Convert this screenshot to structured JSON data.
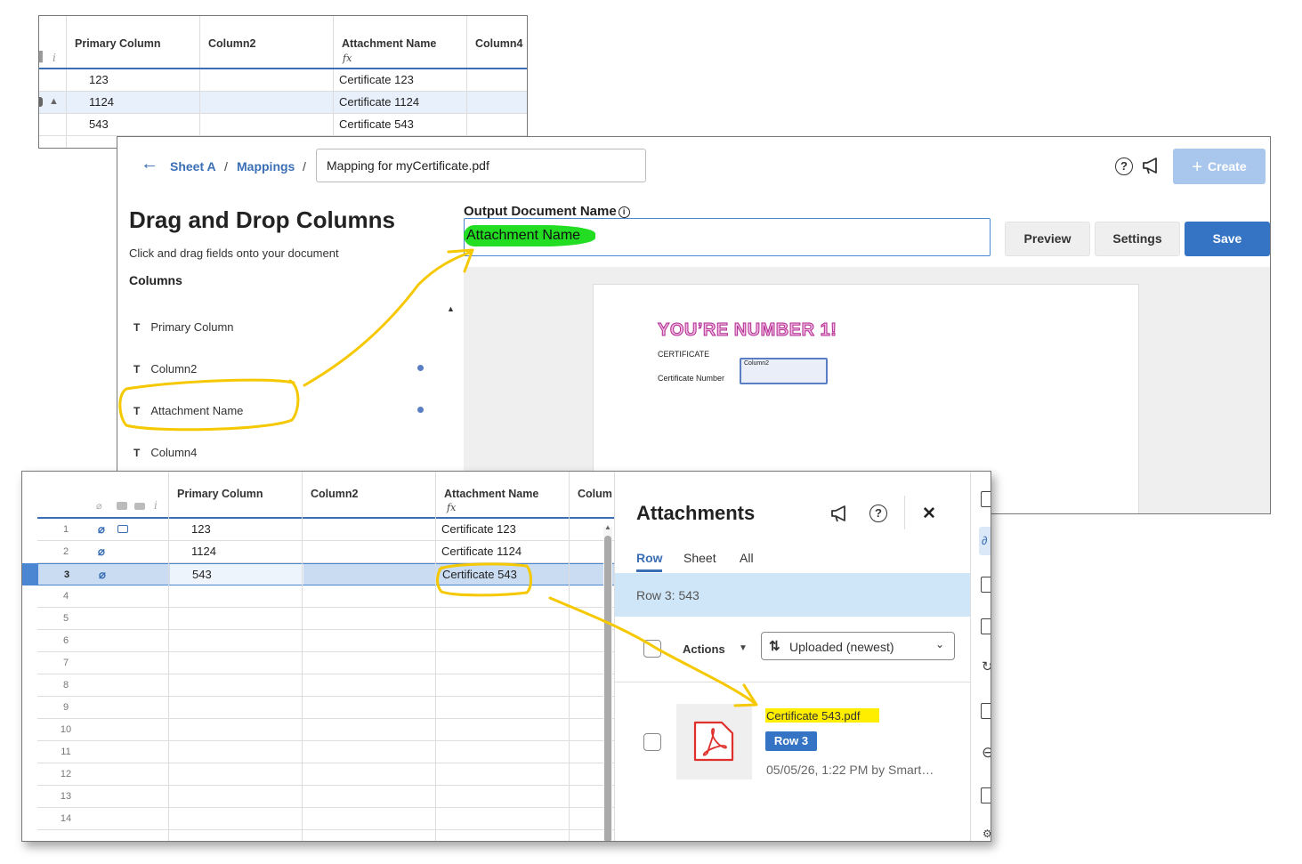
{
  "sheet_small": {
    "columns": [
      "Primary Column",
      "Column2",
      "Attachment Name",
      "Column4"
    ],
    "formula_icon": "fx",
    "info_icon": "i",
    "rows": [
      {
        "primary": "123",
        "column2": "",
        "attachment_name": "Certificate 123"
      },
      {
        "primary": "1124",
        "column2": "",
        "attachment_name": "Certificate 1124"
      },
      {
        "primary": "543",
        "column2": "",
        "attachment_name": "Certificate 543"
      }
    ]
  },
  "mapping": {
    "breadcrumb": {
      "back_icon": "←",
      "sheet": "Sheet A",
      "sep1": "/",
      "mappings": "Mappings",
      "sep2": "/"
    },
    "mapping_name": "Mapping for myCertificate.pdf",
    "help_icon": "?",
    "create_label": "Create",
    "create_icon": "+",
    "title": "Drag and Drop Columns",
    "subtitle": "Click and drag fields onto your document",
    "columns_heading": "Columns",
    "fields": [
      {
        "type": "T",
        "label": "Primary Column"
      },
      {
        "type": "T",
        "label": "Column2"
      },
      {
        "type": "T",
        "label": "Attachment Name"
      },
      {
        "type": "T",
        "label": "Column4"
      }
    ],
    "output_label": "Output Document Name",
    "output_info_icon": "i",
    "output_value": "Attachment Name",
    "preview_label": "Preview",
    "settings_label": "Settings",
    "save_label": "Save",
    "doc": {
      "headline": "YOU’RE NUMBER 1!",
      "certificate": "CERTIFICATE",
      "number_label": "Certificate Number",
      "field_tag": "Column2"
    }
  },
  "sheet_main": {
    "columns": [
      "Primary Column",
      "Column2",
      "Attachment Name",
      "Colum"
    ],
    "formula_icon": "fx",
    "info_icon": "i",
    "rows": [
      {
        "num": "1",
        "primary": "123",
        "attachment_name": "Certificate 123"
      },
      {
        "num": "2",
        "primary": "1124",
        "attachment_name": "Certificate 1124"
      },
      {
        "num": "3",
        "primary": "543",
        "attachment_name": "Certificate 543"
      },
      {
        "num": "4",
        "primary": "",
        "attachment_name": ""
      },
      {
        "num": "5",
        "primary": "",
        "attachment_name": ""
      },
      {
        "num": "6",
        "primary": "",
        "attachment_name": ""
      },
      {
        "num": "7",
        "primary": "",
        "attachment_name": ""
      },
      {
        "num": "8",
        "primary": "",
        "attachment_name": ""
      },
      {
        "num": "9",
        "primary": "",
        "attachment_name": ""
      },
      {
        "num": "10",
        "primary": "",
        "attachment_name": ""
      },
      {
        "num": "11",
        "primary": "",
        "attachment_name": ""
      },
      {
        "num": "12",
        "primary": "",
        "attachment_name": ""
      },
      {
        "num": "13",
        "primary": "",
        "attachment_name": ""
      },
      {
        "num": "14",
        "primary": "",
        "attachment_name": ""
      }
    ]
  },
  "attachments": {
    "title": "Attachments",
    "help_icon": "?",
    "close_icon": "✕",
    "tabs": [
      "Row",
      "Sheet",
      "All"
    ],
    "row_label": "Row 3: 543",
    "actions_label": "Actions",
    "sort_label": "Uploaded (newest)",
    "file": {
      "name": "Certificate 543.pdf",
      "row_badge": "Row 3",
      "meta": "05/05/26, 1:22 PM by Smart…"
    }
  },
  "colors": {
    "accent": "#3574c4",
    "highlight_yellow": "#ffee00",
    "highlight_green": "#22dd22",
    "annotation": "#f5c800",
    "pdf_red": "#e0302b"
  }
}
